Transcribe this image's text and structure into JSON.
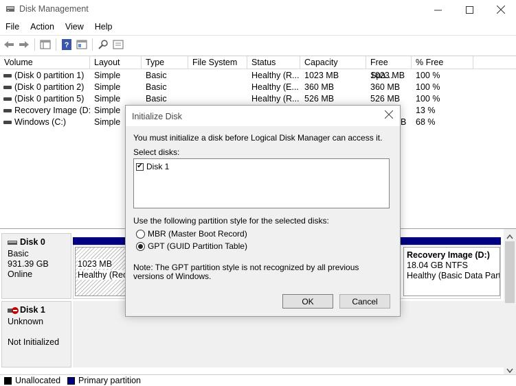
{
  "window": {
    "title": "Disk Management",
    "minimize": "—",
    "maximize": "☐",
    "close": "✕"
  },
  "menu": {
    "items": [
      "File",
      "Action",
      "View",
      "Help"
    ]
  },
  "columns": [
    "Volume",
    "Layout",
    "Type",
    "File System",
    "Status",
    "Capacity",
    "Free Spa...",
    "% Free"
  ],
  "volumes": [
    {
      "volume": "(Disk 0 partition 1)",
      "layout": "Simple",
      "type": "Basic",
      "fs": "",
      "status": "Healthy (R...",
      "capacity": "1023 MB",
      "free": "1023 MB",
      "pct": "100 %"
    },
    {
      "volume": "(Disk 0 partition 2)",
      "layout": "Simple",
      "type": "Basic",
      "fs": "",
      "status": "Healthy (E...",
      "capacity": "360 MB",
      "free": "360 MB",
      "pct": "100 %"
    },
    {
      "volume": "(Disk 0 partition 5)",
      "layout": "Simple",
      "type": "Basic",
      "fs": "",
      "status": "Healthy (R...",
      "capacity": "526 MB",
      "free": "526 MB",
      "pct": "100 %"
    },
    {
      "volume": "Recovery Image (D:)",
      "layout": "Simple",
      "type": "",
      "fs": "",
      "status": "",
      "capacity": "",
      "free": "",
      "pct": "13 %"
    },
    {
      "volume": "Windows (C:)",
      "layout": "Simple",
      "type": "",
      "fs": "",
      "status": "",
      "capacity": "",
      "free": "B",
      "pct": "68 %"
    }
  ],
  "disks": {
    "disk0": {
      "name": "Disk 0",
      "type": "Basic",
      "size": "931.39 GB",
      "state": "Online"
    },
    "disk1": {
      "name": "Disk 1",
      "type": "Unknown",
      "state": "Not Initialized"
    }
  },
  "partitions": {
    "p1": {
      "size": "1023 MB",
      "status": "Healthy (Reco"
    },
    "recovery": {
      "name": "Recovery Image  (D:)",
      "size": "18.04 GB NTFS",
      "status": "Healthy (Basic Data Parti"
    }
  },
  "legend": {
    "unallocated": "Unallocated",
    "primary": "Primary partition"
  },
  "colors": {
    "primary": "#000080",
    "unallocated": "#000000"
  },
  "dialog": {
    "title": "Initialize Disk",
    "intro": "You must initialize a disk before Logical Disk Manager can access it.",
    "select_label": "Select disks:",
    "disk_item": "Disk 1",
    "style_label": "Use the following partition style for the selected disks:",
    "mbr": "MBR (Master Boot Record)",
    "gpt": "GPT (GUID Partition Table)",
    "note": "Note: The GPT partition style is not recognized by all previous versions of Windows.",
    "ok": "OK",
    "cancel": "Cancel"
  }
}
